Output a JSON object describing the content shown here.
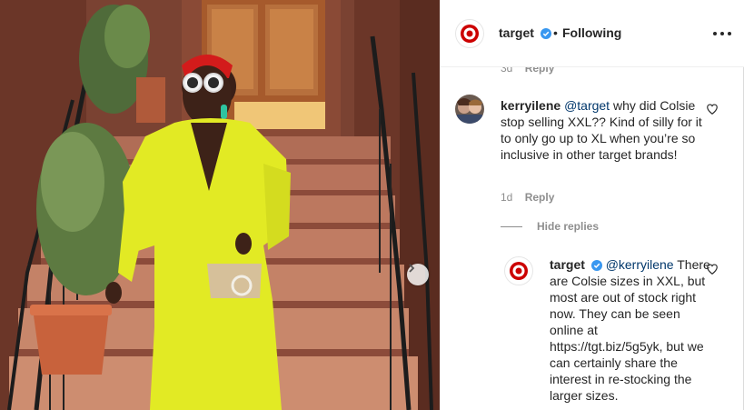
{
  "post": {
    "author": "target",
    "separator": "•",
    "follow_status": "Following"
  },
  "comments": [
    {
      "username": "kerryilene",
      "mention": "@target",
      "text": " why did Colsie stop selling XXL?? Kind of silly for it to only go up to XL when you’re so inclusive in other target brands!",
      "time": "1d",
      "reply_label": "Reply"
    }
  ],
  "previous_meta": {
    "time": "3d",
    "reply_label": "Reply"
  },
  "hide_replies_label": "Hide replies",
  "reply": {
    "username": "target",
    "mention": "@kerryilene",
    "text": " There are Colsie sizes in XXL, but most are out of stock right now. They can be seen online at https://tgt.biz/5g5yk, but we can certainly share the interest in re-stocking the larger sizes."
  },
  "colors": {
    "brand_red": "#cc0000",
    "verified_blue": "#3897f0",
    "dress_yellow": "#e2ea24",
    "muted_text": "#8e8e8e"
  },
  "icons": [
    "target-logo-icon",
    "verified-badge-icon",
    "more-options-icon",
    "heart-icon",
    "chevron-right-icon"
  ]
}
